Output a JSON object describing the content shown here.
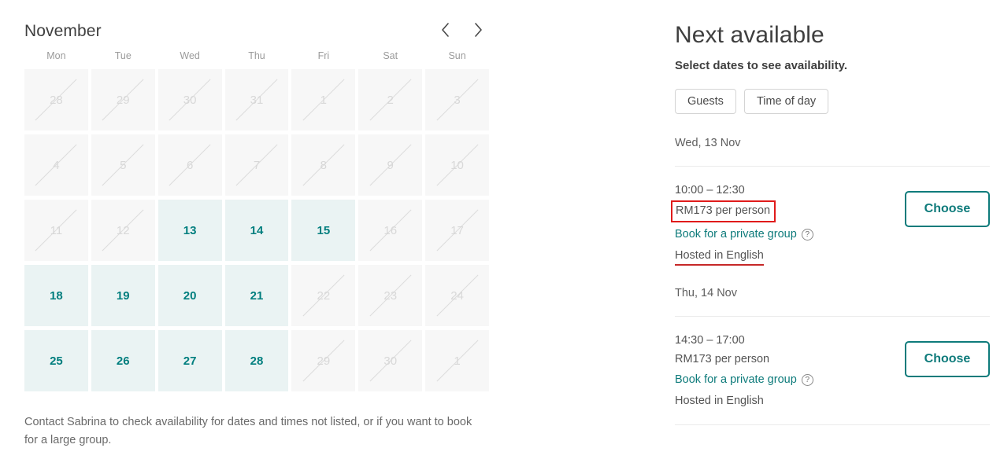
{
  "calendar": {
    "month_label": "November",
    "prev_label": "Previous month",
    "next_label": "Next month",
    "weekdays": [
      "Mon",
      "Tue",
      "Wed",
      "Thu",
      "Fri",
      "Sat",
      "Sun"
    ],
    "weeks": [
      [
        {
          "num": "28",
          "state": "disabled"
        },
        {
          "num": "29",
          "state": "disabled"
        },
        {
          "num": "30",
          "state": "disabled"
        },
        {
          "num": "31",
          "state": "disabled"
        },
        {
          "num": "1",
          "state": "disabled"
        },
        {
          "num": "2",
          "state": "disabled"
        },
        {
          "num": "3",
          "state": "disabled"
        }
      ],
      [
        {
          "num": "4",
          "state": "disabled"
        },
        {
          "num": "5",
          "state": "disabled"
        },
        {
          "num": "6",
          "state": "disabled"
        },
        {
          "num": "7",
          "state": "disabled"
        },
        {
          "num": "8",
          "state": "disabled"
        },
        {
          "num": "9",
          "state": "disabled"
        },
        {
          "num": "10",
          "state": "disabled"
        }
      ],
      [
        {
          "num": "11",
          "state": "disabled"
        },
        {
          "num": "12",
          "state": "disabled"
        },
        {
          "num": "13",
          "state": "available"
        },
        {
          "num": "14",
          "state": "available"
        },
        {
          "num": "15",
          "state": "available"
        },
        {
          "num": "16",
          "state": "disabled"
        },
        {
          "num": "17",
          "state": "disabled"
        }
      ],
      [
        {
          "num": "18",
          "state": "available"
        },
        {
          "num": "19",
          "state": "available"
        },
        {
          "num": "20",
          "state": "available"
        },
        {
          "num": "21",
          "state": "available"
        },
        {
          "num": "22",
          "state": "disabled"
        },
        {
          "num": "23",
          "state": "disabled"
        },
        {
          "num": "24",
          "state": "disabled"
        }
      ],
      [
        {
          "num": "25",
          "state": "available"
        },
        {
          "num": "26",
          "state": "available"
        },
        {
          "num": "27",
          "state": "available"
        },
        {
          "num": "28",
          "state": "available"
        },
        {
          "num": "29",
          "state": "disabled"
        },
        {
          "num": "30",
          "state": "disabled"
        },
        {
          "num": "1",
          "state": "disabled"
        }
      ]
    ],
    "note": "Contact Sabrina to check availability for dates and times not listed, or if you want to book for a large group."
  },
  "availability": {
    "title": "Next available",
    "subtitle": "Select dates to see availability.",
    "filters": [
      {
        "label": "Guests"
      },
      {
        "label": "Time of day"
      }
    ],
    "groups": [
      {
        "date": "Wed, 13 Nov",
        "slots": [
          {
            "time": "10:00 – 12:30",
            "price": "RM173 per person",
            "private_group": "Book for a private group",
            "language": "Hosted in English",
            "choose_label": "Choose",
            "price_highlighted": true,
            "language_underlined": true
          }
        ]
      },
      {
        "date": "Thu, 14 Nov",
        "slots": [
          {
            "time": "14:30 – 17:00",
            "price": "RM173 per person",
            "private_group": "Book for a private group",
            "language": "Hosted in English",
            "choose_label": "Choose",
            "price_highlighted": false,
            "language_underlined": false
          }
        ]
      }
    ]
  },
  "colors": {
    "teal": "#0e7b7b",
    "available_bg": "#eaf3f3",
    "disabled_bg": "#f7f7f7",
    "highlight_red": "#e01b1b"
  }
}
